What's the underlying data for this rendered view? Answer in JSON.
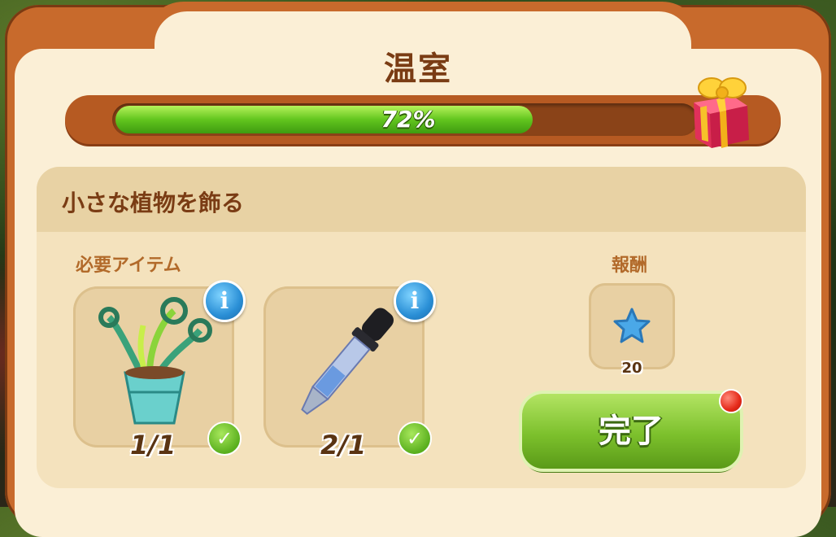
{
  "header": {
    "title": "温室"
  },
  "progress": {
    "percent": 72,
    "label": "72%"
  },
  "task": {
    "title": "小さな植物を飾る"
  },
  "required": {
    "label": "必要アイテム",
    "items": [
      {
        "icon": "fern-in-pot-icon",
        "count": "1/1",
        "completed": true
      },
      {
        "icon": "dropper-pipette-icon",
        "count": "2/1",
        "completed": true
      }
    ]
  },
  "reward": {
    "label": "報酬",
    "icon": "blue-star-icon",
    "amount": "20"
  },
  "actions": {
    "complete_label": "完了"
  },
  "colors": {
    "accent_green": "#7cc02c",
    "frame_orange": "#c86a2c",
    "title_brown": "#7a3c14"
  }
}
